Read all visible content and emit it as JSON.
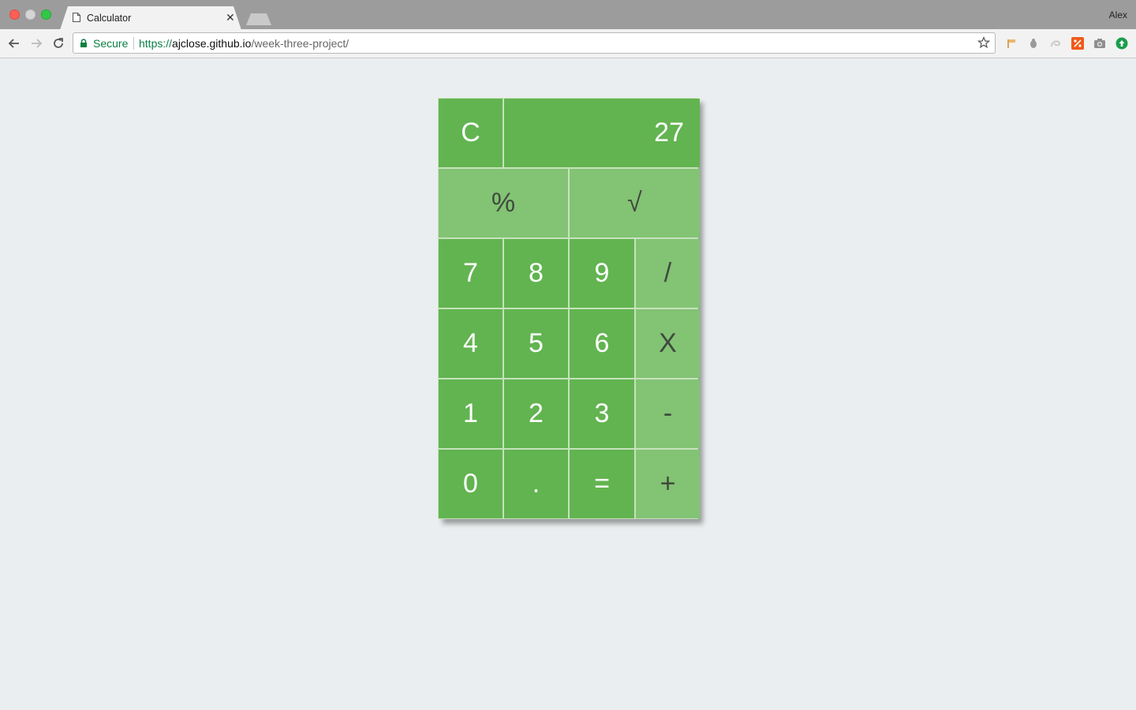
{
  "browser": {
    "tab_title": "Calculator",
    "profile_name": "Alex",
    "secure_label": "Secure",
    "url_scheme": "https://",
    "url_host": "ajclose.github.io",
    "url_path": "/week-three-project/"
  },
  "calculator": {
    "display_value": "27",
    "clear_label": "C",
    "percent_label": "%",
    "sqrt_label": "√",
    "rows": [
      [
        {
          "label": "7",
          "style": "dark"
        },
        {
          "label": "8",
          "style": "dark"
        },
        {
          "label": "9",
          "style": "dark"
        },
        {
          "label": "/",
          "style": "light"
        }
      ],
      [
        {
          "label": "4",
          "style": "dark"
        },
        {
          "label": "5",
          "style": "dark"
        },
        {
          "label": "6",
          "style": "dark"
        },
        {
          "label": "X",
          "style": "light"
        }
      ],
      [
        {
          "label": "1",
          "style": "dark"
        },
        {
          "label": "2",
          "style": "dark"
        },
        {
          "label": "3",
          "style": "dark"
        },
        {
          "label": "-",
          "style": "light"
        }
      ],
      [
        {
          "label": "0",
          "style": "dark"
        },
        {
          "label": ".",
          "style": "dark"
        },
        {
          "label": "=",
          "style": "dark"
        },
        {
          "label": "+",
          "style": "light"
        }
      ]
    ],
    "colors": {
      "digit_key": "#62b450",
      "operator_key": "#83c374",
      "page_background": "#ebeef0"
    }
  }
}
